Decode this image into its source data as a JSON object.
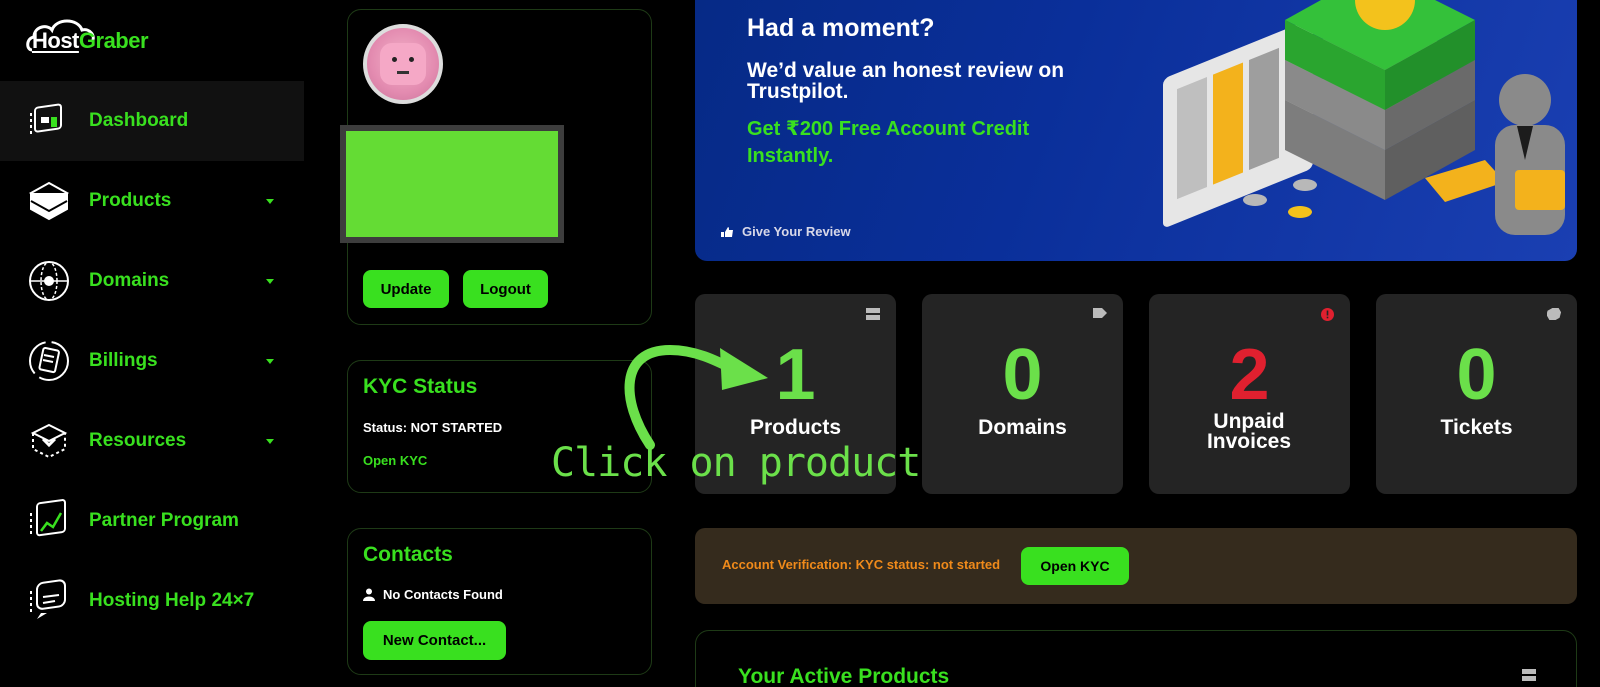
{
  "brand": {
    "host": "Host",
    "graber": "Graber"
  },
  "nav": {
    "items": [
      {
        "label": "Dashboard",
        "icon": "dashboard-icon",
        "active": true,
        "caret": false
      },
      {
        "label": "Products",
        "icon": "products-box-icon",
        "active": false,
        "caret": true
      },
      {
        "label": "Domains",
        "icon": "globe-icon",
        "active": false,
        "caret": true
      },
      {
        "label": "Billings",
        "icon": "billing-icon",
        "active": false,
        "caret": true
      },
      {
        "label": "Resources",
        "icon": "resources-box-icon",
        "active": false,
        "caret": true
      },
      {
        "label": "Partner Program",
        "icon": "partner-chart-icon",
        "active": false,
        "caret": false
      },
      {
        "label": "Hosting Help 24×7",
        "icon": "help-chat-icon",
        "active": false,
        "caret": false
      }
    ]
  },
  "profile": {
    "update_label": "Update",
    "logout_label": "Logout"
  },
  "kyc": {
    "title": "KYC Status",
    "status": "Status: NOT STARTED",
    "link": "Open KYC"
  },
  "contacts": {
    "title": "Contacts",
    "none": "No Contacts Found",
    "new_label": "New Contact..."
  },
  "banner": {
    "heading": "Had a moment?",
    "subheading": "We’d value an honest review on Trustpilot.",
    "offer": "Get ₹200 Free Account Credit Instantly.",
    "review_link": "Give Your Review"
  },
  "stats": [
    {
      "value": "1",
      "label": "Products",
      "icon": "server-icon",
      "color": "#6be04a"
    },
    {
      "value": "0",
      "label": "Domains",
      "icon": "tag-icon",
      "color": "#6be04a"
    },
    {
      "value": "2",
      "label": "Unpaid Invoices",
      "icon": "alert-icon",
      "color": "#e0202f"
    },
    {
      "value": "0",
      "label": "Tickets",
      "icon": "ticket-icon",
      "color": "#6be04a"
    }
  ],
  "annotation": {
    "text": "Click on product"
  },
  "alert": {
    "text": "Account Verification: KYC status: not started",
    "button": "Open KYC"
  },
  "active_products": {
    "title": "Your Active Products"
  },
  "colors": {
    "accent": "#39e01f",
    "danger": "#e0202f",
    "warning": "#f08a1a",
    "banner": "#0a2f9a"
  }
}
